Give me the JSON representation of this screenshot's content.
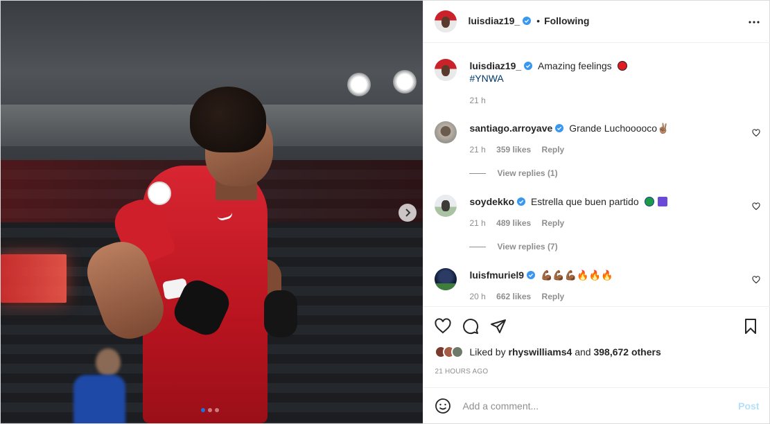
{
  "post": {
    "author": "luisdiaz19_",
    "follow_status": "Following",
    "caption": "Amazing feelings",
    "hashtag": "#YNWA",
    "caption_time": "21 h"
  },
  "comments": [
    {
      "username": "santiago.arroyave",
      "text": "Grande Luchooooco✌🏽",
      "time": "21 h",
      "likes": "359 likes",
      "reply": "Reply",
      "view_replies": "View replies (1)"
    },
    {
      "username": "soydekko",
      "text": "Estrella que buen partido",
      "time": "21 h",
      "likes": "489 likes",
      "reply": "Reply",
      "view_replies": "View replies (7)"
    },
    {
      "username": "luisfmuriel9",
      "text": "💪🏾💪🏾💪🏾🔥🔥🔥",
      "time": "20 h",
      "likes": "662 likes",
      "reply": "Reply"
    }
  ],
  "likes": {
    "prefix": "Liked by",
    "user": "rhyswilliams4",
    "connector": "and",
    "others": "398,672 others"
  },
  "time_ago": "21 HOURS AGO",
  "add_comment": {
    "placeholder": "Add a comment...",
    "post_label": "Post"
  },
  "colors": {
    "verified": "#3897f0",
    "link": "#00376b",
    "muted": "#8e8e8e",
    "post_disabled": "#b2dffc",
    "carousel_active": "#1a73e8"
  },
  "icons": [
    "more-options-icon",
    "heart-icon",
    "comment-icon",
    "share-icon",
    "bookmark-icon",
    "emoji-icon",
    "chevron-right-icon",
    "verified-icon"
  ]
}
